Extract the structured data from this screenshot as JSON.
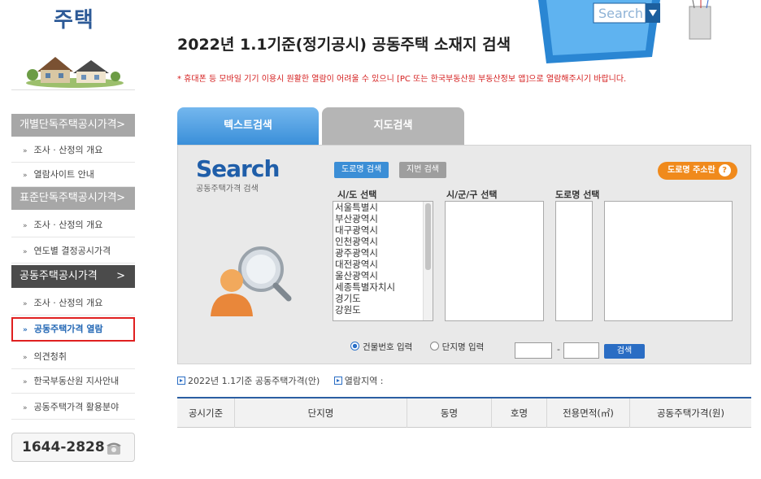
{
  "sidebar": {
    "title": "주택",
    "categories": [
      {
        "label": "개별단독주택공시가격",
        "arrow": ">"
      },
      {
        "label": "표준단독주택공시가격",
        "arrow": ">"
      },
      {
        "label": "공동주택공시가격",
        "arrow": ">"
      }
    ],
    "items": [
      "조사 · 산정의 개요",
      "열람사이트 안내",
      "조사 · 산정의 개요",
      "연도별 결정공시가격",
      "조사 · 산정의 개요",
      "공동주택가격 열람",
      "의견청취",
      "한국부동산원 지사안내",
      "공동주택가격 활용분야"
    ],
    "bullet": "»",
    "phone": "1644-2828"
  },
  "main": {
    "title": "2022년 1.1기준(정기공시) 공동주택 소재지 검색",
    "notice": "* 휴대폰 등 모바일 기기 이용시 원활한 열람이 어려울 수 있으니 [PC 또는 한국부동산원 부동산정보 앱]으로 열람해주시기 바랍니다.",
    "tabs": {
      "text_search": "텍스트검색",
      "map_search": "지도검색"
    },
    "deco_text": "Search",
    "search": {
      "logo": "Search",
      "logo_sub": "공동주택가격 검색",
      "road_btn": "도로명 검색",
      "jibun_btn": "지번 검색",
      "addr_btn": "도로명 주소란",
      "addr_q": "?",
      "label_city": "시/도 선택",
      "label_district": "시/군/구 선택",
      "label_road": "도로명 선택",
      "cities": [
        "서울특별시",
        "부산광역시",
        "대구광역시",
        "인천광역시",
        "광주광역시",
        "대전광역시",
        "울산광역시",
        "세종특별자치시",
        "경기도",
        "강원도"
      ],
      "radio_building": "건물번호 입력",
      "radio_complex": "단지명 입력",
      "dash": "-",
      "search_btn": "검색"
    },
    "info_year": "2022년 1.1기준 공동주택가격(안)",
    "info_region": "열람지역 :",
    "table_headers": [
      "공시기준",
      "단지명",
      "동명",
      "호명",
      "전용면적(㎡)",
      "공동주택가격(원)"
    ]
  },
  "colors": {
    "accent_blue": "#3b8ed6",
    "title_blue": "#2d5a97",
    "orange": "#f08a1c",
    "notice_red": "#d52020"
  }
}
